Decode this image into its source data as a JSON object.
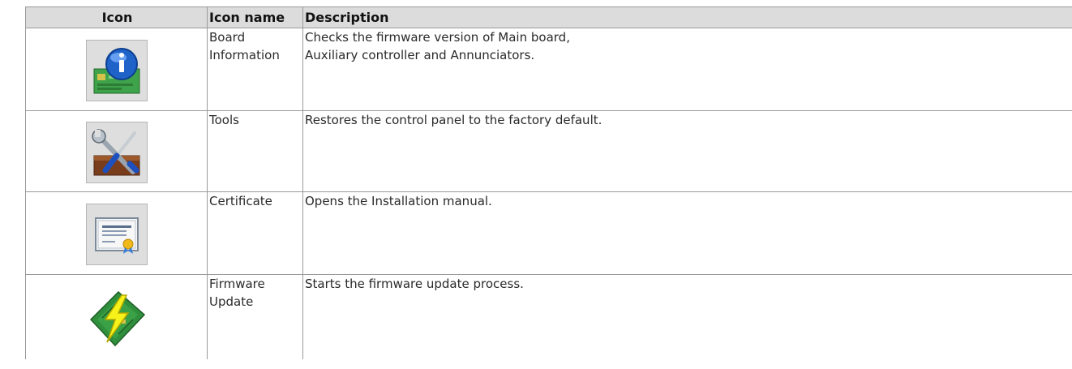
{
  "table": {
    "headers": {
      "icon": "Icon",
      "icon_name": "Icon name",
      "description": "Description"
    },
    "rows": [
      {
        "icon": "board-information-icon",
        "name_line1": "Board",
        "name_line2": "Information",
        "desc_line1": "Checks the firmware version of Main board,",
        "desc_line2": "Auxiliary controller and Annunciators."
      },
      {
        "icon": "tools-icon",
        "name_line1": "Tools",
        "name_line2": "",
        "desc_line1": "Restores the control panel to the factory default.",
        "desc_line2": ""
      },
      {
        "icon": "certificate-icon",
        "name_line1": "Certificate",
        "name_line2": "",
        "desc_line1": "Opens the Installation manual.",
        "desc_line2": ""
      },
      {
        "icon": "firmware-update-icon",
        "name_line1": "Firmware",
        "name_line2": "Update",
        "desc_line1": "Starts the firmware update process.",
        "desc_line2": ""
      }
    ]
  }
}
